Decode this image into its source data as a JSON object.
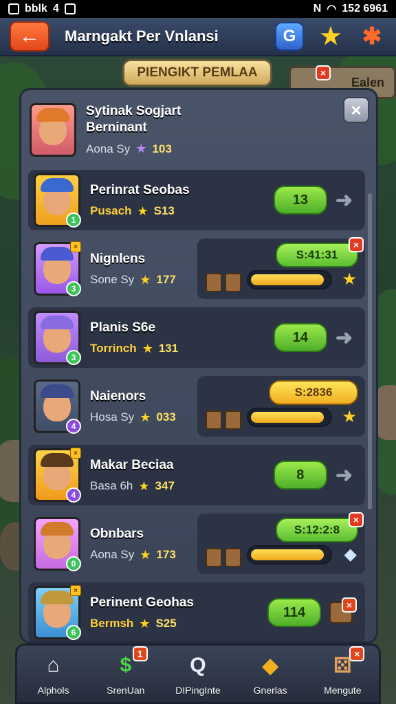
{
  "status_bar": {
    "left_text": "bblk",
    "signal": "4",
    "right_text": "152 6961",
    "icons": [
      "photo-icon",
      "wifi-icon",
      "alarm-icon",
      "nfc-icon"
    ]
  },
  "top_bar": {
    "title": "Marngakt Per Vnlansi",
    "back_icon": "arrow-left-icon",
    "blue_badge": "G",
    "icons": [
      "blue-badge-icon",
      "star-shape-icon",
      "puzzle-x-icon"
    ]
  },
  "rank_banner": "PIENGIKT PEMLAA",
  "side_sign": "Ealen",
  "panel": {
    "header": {
      "name_line1": "Sytinak Sogjart",
      "name_line2": "Berninant",
      "sub": "Aona Sy",
      "points": "103"
    },
    "rows": [
      {
        "name": "Perinrat Seobas",
        "sub": "Pusach",
        "points": "S13",
        "pill": "13",
        "level": "1"
      },
      {
        "name": "Nignlens",
        "sub": "Sone Sy",
        "points": "177",
        "timer": "S:41:31",
        "level": "3",
        "bar": 0.95
      },
      {
        "name": "Planis S6e",
        "sub": "Torrinch",
        "points": "131",
        "pill": "14",
        "level": "3"
      },
      {
        "name": "Naienors",
        "sub": "Hosa Sy",
        "points": "033",
        "timer": "S:2836",
        "level": "4",
        "bar": 0.95
      },
      {
        "name": "Makar Beciaa",
        "sub": "Basa 6h",
        "points": "347",
        "pill": "8",
        "level": "4"
      },
      {
        "name": "Obnbars",
        "sub": "Aona Sy",
        "points": "173",
        "timer": "S:12:2:8",
        "level": "0",
        "bar": 0.95
      },
      {
        "name": "Perinent Geohas",
        "sub": "Bermsh",
        "points": "S25",
        "pill": "114",
        "level": "6"
      }
    ]
  },
  "bottom_nav": [
    {
      "label": "Alphols",
      "icon": "home-icon"
    },
    {
      "label": "SrenUan",
      "icon": "money-icon",
      "badge": "1"
    },
    {
      "label": "DIPingInte",
      "icon": "search-icon"
    },
    {
      "label": "Gnerlas",
      "icon": "gem-icon"
    },
    {
      "label": "Mengute",
      "icon": "dice-icon"
    }
  ],
  "colors": {
    "accent_green": "#5cbf32",
    "accent_gold": "#ffd21f",
    "panel_bg": "#4a5468",
    "back_button": "#e2461b"
  }
}
